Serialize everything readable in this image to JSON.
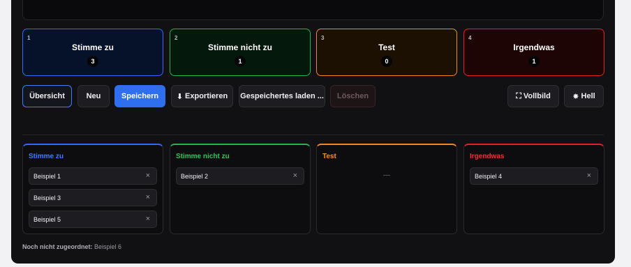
{
  "counters": [
    {
      "num": "1",
      "label": "Stimme zu",
      "count": "3"
    },
    {
      "num": "2",
      "label": "Stimme nicht zu",
      "count": "1"
    },
    {
      "num": "3",
      "label": "Test",
      "count": "0"
    },
    {
      "num": "4",
      "label": "Irgendwas",
      "count": "1"
    }
  ],
  "toolbar": {
    "overview": "Übersicht",
    "new": "Neu",
    "save": "Speichern",
    "export": "Exportieren",
    "load": "Gespeichertes laden ...",
    "delete": "Löschen",
    "fullscreen": "Vollbild",
    "light": "Hell"
  },
  "icons": {
    "download": "⬇",
    "fullscreen": "⛶",
    "sun": "✸",
    "remove": "×"
  },
  "columns": [
    {
      "title": "Stimme zu",
      "items": [
        "Beispiel 1",
        "Beispiel 3",
        "Beispiel 5"
      ]
    },
    {
      "title": "Stimme nicht zu",
      "items": [
        "Beispiel 2"
      ]
    },
    {
      "title": "Test",
      "items": [],
      "empty": "—"
    },
    {
      "title": "Irgendwas",
      "items": [
        "Beispiel 4"
      ]
    }
  ],
  "unassigned": {
    "label": "Noch nicht zugeordnet:",
    "value": "Beispiel 6"
  },
  "colors": {
    "blue": "#2f6bff",
    "green": "#23b54a",
    "orange": "#f08a1e",
    "red": "#e02323"
  }
}
